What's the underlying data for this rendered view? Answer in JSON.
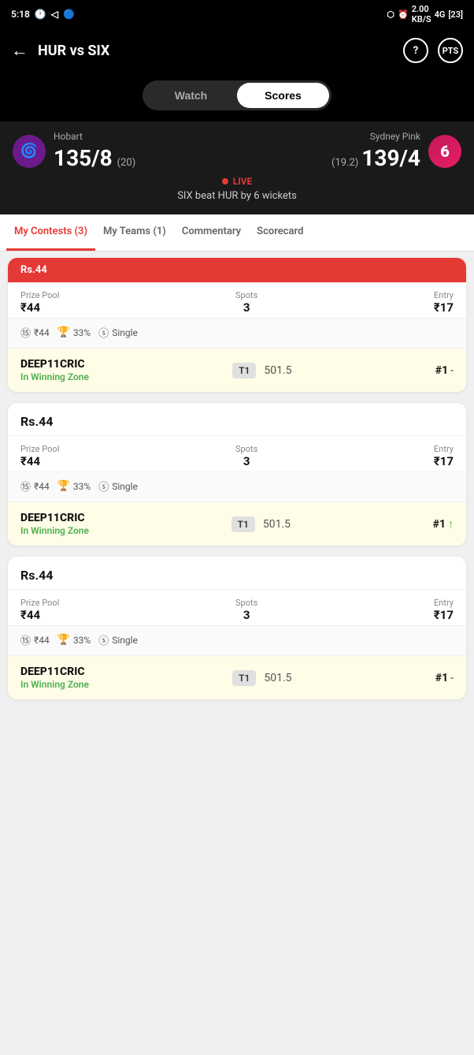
{
  "statusBar": {
    "time": "5:18",
    "icons": [
      "bluetooth",
      "alarm",
      "speed",
      "network",
      "battery"
    ]
  },
  "header": {
    "title": "HUR vs SIX",
    "backArrow": "←",
    "chatIconLabel": "?",
    "pointsIconLabel": "PTS"
  },
  "tabToggle": {
    "watchLabel": "Watch",
    "scoresLabel": "Scores",
    "activeTab": "Scores"
  },
  "scoreSection": {
    "team1Name": "Hobart",
    "team1Score": "135/8",
    "team1Overs": "(20)",
    "team1LogoEmoji": "🌀",
    "team2Name": "Sydney Pink",
    "team2Score": "139/4",
    "team2Overs": "(19.2)",
    "team2LogoEmoji": "6",
    "liveLabel": "LIVE",
    "resultText": "SIX beat HUR by 6 wickets"
  },
  "mainTabs": [
    {
      "id": "my-contests",
      "label": "My Contests (3)",
      "active": true
    },
    {
      "id": "my-teams",
      "label": "My Teams (1)",
      "active": false
    },
    {
      "id": "commentary",
      "label": "Commentary",
      "active": false
    },
    {
      "id": "scorecard",
      "label": "Scorecard",
      "active": false
    }
  ],
  "cards": [
    {
      "id": "card-partial",
      "partialHeaderText": "Rs.44",
      "prizePoolLabel": "Prize Pool",
      "prizePoolValue": "₹44",
      "spotsLabel": "Spots",
      "spotsValue": "3",
      "entryLabel": "Entry",
      "entryValue": "₹17",
      "badge1Icon": "⑮",
      "badge1Text": "₹44",
      "badge2Icon": "🏆",
      "badge2Text": "33%",
      "badge3Icon": "ⓢ",
      "badge3Text": "Single",
      "teamName": "DEEP11CRIC",
      "teamBadge": "T1",
      "teamPoints": "501.5",
      "teamRank": "#1",
      "teamRankSuffix": "-",
      "winningZone": "In Winning Zone",
      "hasArrow": false
    },
    {
      "id": "card-1",
      "title": "Rs.44",
      "prizePoolLabel": "Prize Pool",
      "prizePoolValue": "₹44",
      "spotsLabel": "Spots",
      "spotsValue": "3",
      "entryLabel": "Entry",
      "entryValue": "₹17",
      "badge1Icon": "⑮",
      "badge1Text": "₹44",
      "badge2Icon": "🏆",
      "badge2Text": "33%",
      "badge3Icon": "ⓢ",
      "badge3Text": "Single",
      "teamName": "DEEP11CRIC",
      "teamBadge": "T1",
      "teamPoints": "501.5",
      "teamRank": "#1",
      "teamRankSuffix": "↑",
      "winningZone": "In Winning Zone",
      "hasArrow": true
    },
    {
      "id": "card-2",
      "title": "Rs.44",
      "prizePoolLabel": "Prize Pool",
      "prizePoolValue": "₹44",
      "spotsLabel": "Spots",
      "spotsValue": "3",
      "entryLabel": "Entry",
      "entryValue": "₹17",
      "badge1Icon": "⑮",
      "badge1Text": "₹44",
      "badge2Icon": "🏆",
      "badge2Text": "33%",
      "badge3Icon": "ⓢ",
      "badge3Text": "Single",
      "teamName": "DEEP11CRIC",
      "teamBadge": "T1",
      "teamPoints": "501.5",
      "teamRank": "#1",
      "teamRankSuffix": "-",
      "winningZone": "In Winning Zone",
      "hasArrow": false
    }
  ]
}
